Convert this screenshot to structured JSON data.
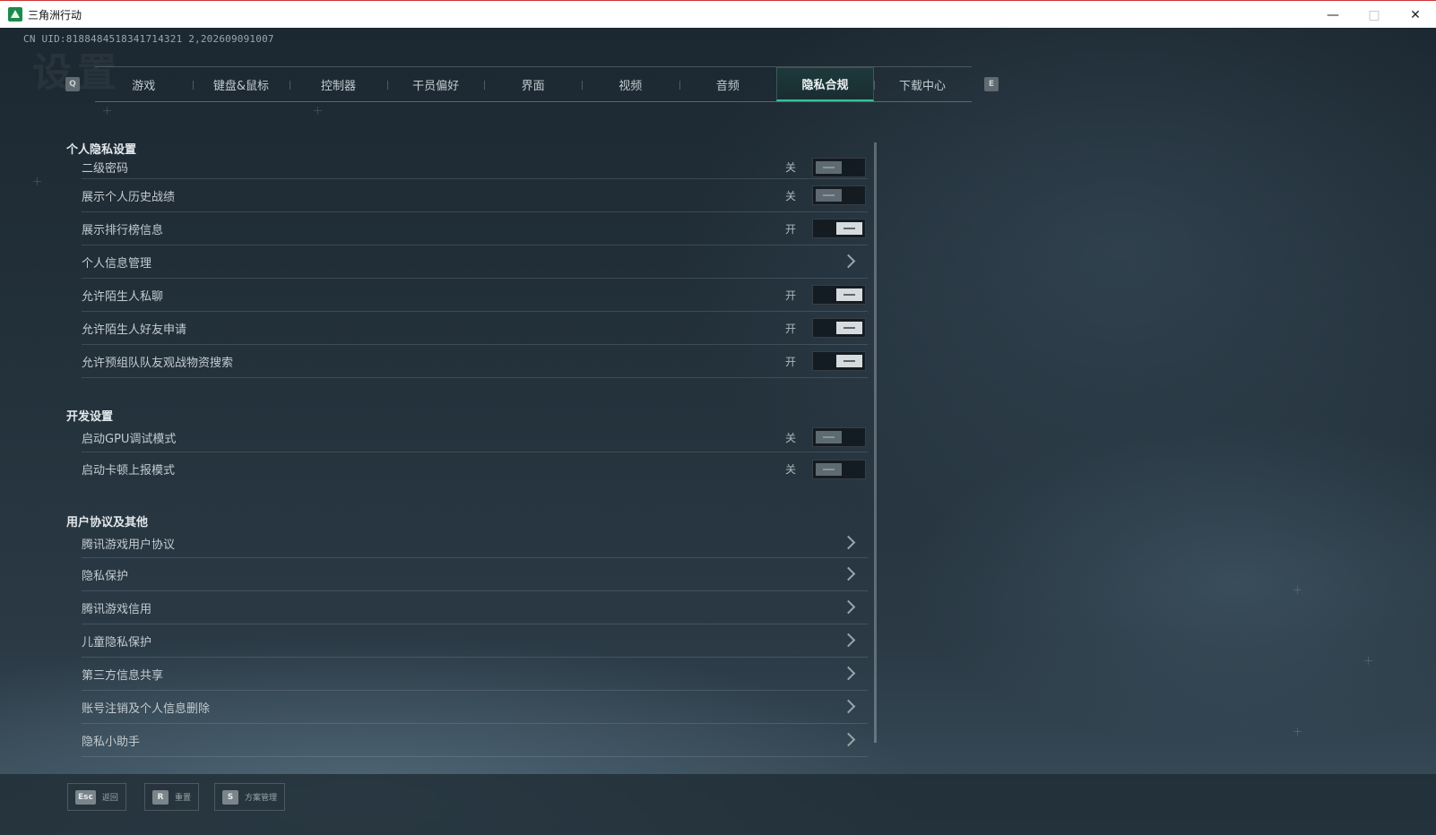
{
  "window": {
    "title": "三角洲行动",
    "minimize": "—",
    "maximize": "□",
    "close": "✕"
  },
  "uid": "CN UID:8188484518341714321 2,202609091007",
  "tabs": {
    "prev_key": "Q",
    "next_key": "E",
    "items": [
      "游戏",
      "键盘&鼠标",
      "控制器",
      "干员偏好",
      "界面",
      "视频",
      "音频",
      "隐私合规",
      "下载中心"
    ],
    "active": "隐私合规"
  },
  "sections": {
    "privacy": {
      "title": "个人隐私设置",
      "rows": [
        {
          "label": "二级密码",
          "state": "关"
        },
        {
          "label": "展示个人历史战绩",
          "state": "关"
        },
        {
          "label": "展示排行榜信息",
          "state": "开"
        },
        {
          "label": "个人信息管理"
        },
        {
          "label": "允许陌生人私聊",
          "state": "开"
        },
        {
          "label": "允许陌生人好友申请",
          "state": "开"
        },
        {
          "label": "允许预组队队友观战物资搜索",
          "state": "开"
        }
      ]
    },
    "dev": {
      "title": "开发设置",
      "rows": [
        {
          "label": "启动GPU调试模式",
          "state": "关"
        },
        {
          "label": "启动卡顿上报模式",
          "state": "关"
        }
      ]
    },
    "agreements": {
      "title": "用户协议及其他",
      "rows": [
        {
          "label": "腾讯游戏用户协议"
        },
        {
          "label": "隐私保护"
        },
        {
          "label": "腾讯游戏信用"
        },
        {
          "label": "儿童隐私保护"
        },
        {
          "label": "第三方信息共享"
        },
        {
          "label": "账号注销及个人信息删除"
        },
        {
          "label": "隐私小助手"
        }
      ]
    }
  },
  "footer": {
    "back": {
      "key": "Esc",
      "label": "返回"
    },
    "reset": {
      "key": "R",
      "label": "重置"
    },
    "scheme": {
      "key": "S",
      "label": "方案管理"
    }
  },
  "colors": {
    "accent": "#33c29a",
    "background": "#1e2a33"
  }
}
